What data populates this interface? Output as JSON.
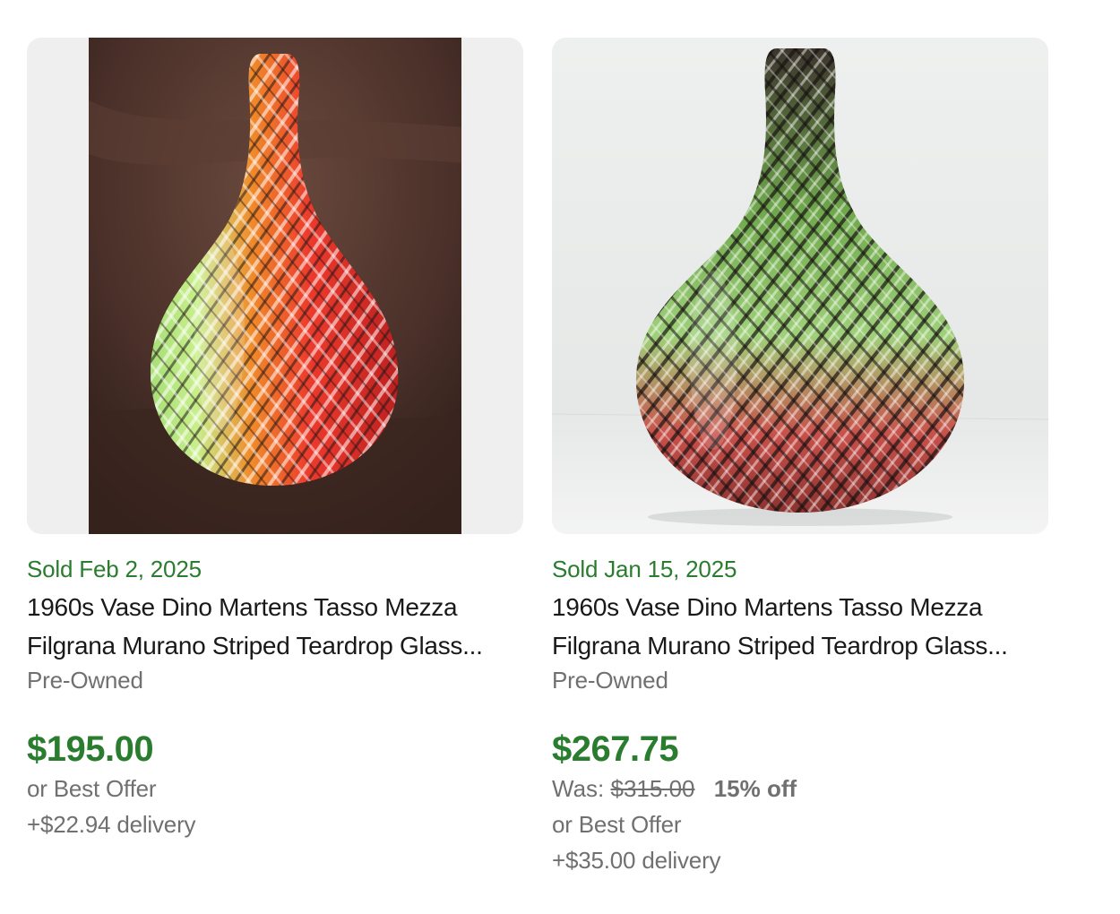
{
  "listings": [
    {
      "image_alt": "Striped teardrop glass vase, red, orange, green on brown leather background",
      "sold_label": "Sold Feb 2, 2025",
      "title": "1960s Vase Dino Martens Tasso Mezza Filgrana Murano Striped Teardrop Glass...",
      "condition": "Pre-Owned",
      "price": "$195.00",
      "best_offer": "or Best Offer",
      "delivery": "+$22.94 delivery"
    },
    {
      "image_alt": "Striped teardrop glass vase, green, red and black on white background",
      "sold_label": "Sold Jan 15, 2025",
      "title": "1960s Vase Dino Martens Tasso Mezza Filgrana Murano Striped Teardrop Glass...",
      "condition": "Pre-Owned",
      "price": "$267.75",
      "was_label": "Was:",
      "was_price": "$315.00",
      "discount": "15% off",
      "best_offer": "or Best Offer",
      "delivery": "+$35.00 delivery"
    }
  ],
  "colors": {
    "sold_green": "#2a7d2e",
    "muted_text": "#707070",
    "title_text": "#191919",
    "image_bg": "#efefef"
  }
}
